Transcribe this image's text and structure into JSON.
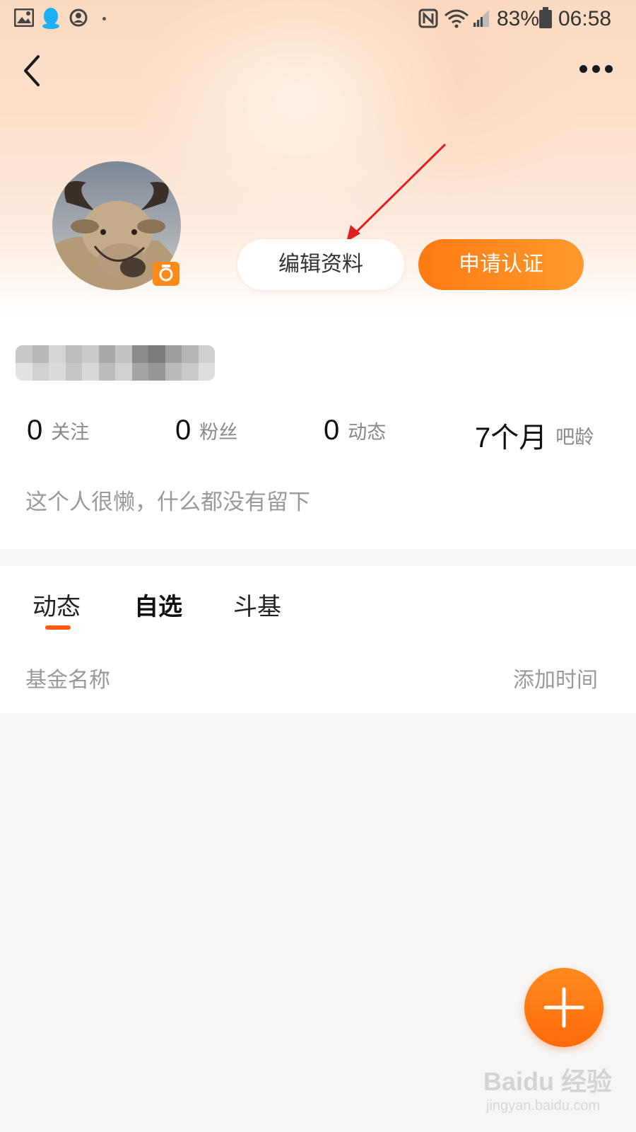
{
  "status_bar": {
    "battery": "83%",
    "time": "06:58",
    "icons": [
      "gallery-icon",
      "qq-icon",
      "account-icon",
      "dot-icon",
      "nfc-icon",
      "wifi-icon",
      "signal-icon",
      "battery-icon"
    ]
  },
  "nav": {
    "back_icon": "chevron-left-icon",
    "more_icon": "more-dots-icon"
  },
  "profile": {
    "avatar": "avatar-bull-photo",
    "camera_badge": "camera-icon",
    "edit_label": "编辑资料",
    "certify_label": "申请认证",
    "bio": "这个人很懒，什么都没有留下"
  },
  "stats": [
    {
      "value": "0",
      "label": "关注"
    },
    {
      "value": "0",
      "label": "粉丝"
    },
    {
      "value": "0",
      "label": "动态"
    },
    {
      "value": "7个月",
      "label": "吧龄"
    }
  ],
  "tabs": [
    {
      "label": "动态",
      "active": true
    },
    {
      "label": "自选",
      "active": false
    },
    {
      "label": "斗基",
      "active": false
    }
  ],
  "table_header": {
    "left": "基金名称",
    "right": "添加时间"
  },
  "fab": {
    "icon": "plus-icon"
  },
  "watermark": {
    "text": "Baidu 经验",
    "sub": "jingyan.baidu.com"
  },
  "colors": {
    "accent": "#ff7a12",
    "tab_indicator": "#ff5a14",
    "annotation_arrow": "#e02020"
  }
}
